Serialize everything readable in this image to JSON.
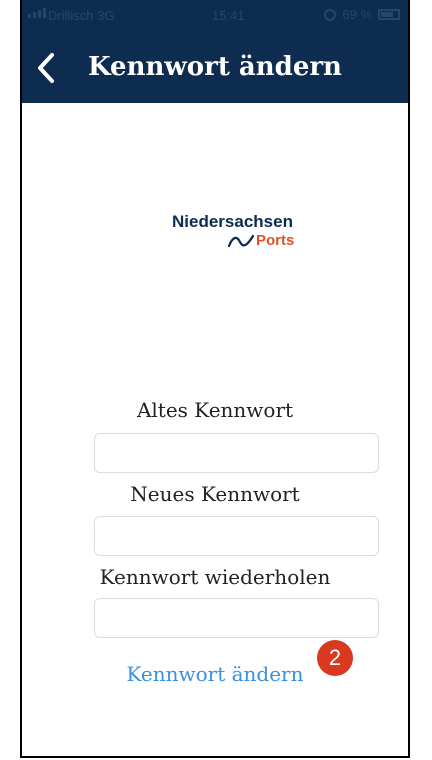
{
  "status_bar": {
    "carrier": "Drillisch  3G",
    "time": "15:41",
    "battery": "69 %",
    "icons": [
      "signal-icon",
      "lock-rotation-icon",
      "battery-icon"
    ]
  },
  "nav": {
    "back_icon": "chevron-left-icon",
    "title": "Kennwort ändern"
  },
  "logo": {
    "line1": "Niedersachsen",
    "line2": "Ports",
    "colors": {
      "primary": "#0e2c4f",
      "accent": "#e0522a"
    }
  },
  "form": {
    "old_label": "Altes Kennwort",
    "old_value": "",
    "new_label": "Neues Kennwort",
    "new_value": "",
    "repeat_label": "Kennwort wiederholen",
    "repeat_value": "",
    "submit_label": "Kennwort ändern"
  },
  "annotation": {
    "badge": "2"
  },
  "colors": {
    "header": "#0e2c4f",
    "link": "#3d8fe0",
    "badge": "#d9391e"
  }
}
